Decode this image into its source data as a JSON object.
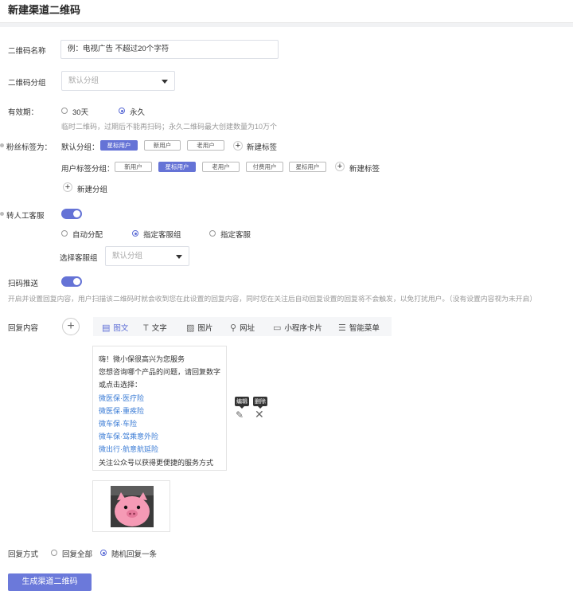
{
  "page": {
    "title": "新建渠道二维码"
  },
  "name_field": {
    "label": "二维码名称",
    "value": "例：电视广告 不超过20个字符"
  },
  "group_field": {
    "label": "二维码分组",
    "placeholder": "默认分组"
  },
  "validity": {
    "label": "有效期：",
    "options": [
      "30天",
      "永久"
    ],
    "selected": "永久",
    "hint": "临时二维码，过期后不能再扫码；永久二维码最大创建数量为10万个"
  },
  "fan_tags": {
    "label": "粉丝标签为：",
    "default_group": {
      "label": "默认分组：",
      "tags": [
        "星标用户",
        "新用户",
        "老用户"
      ],
      "selected": "星标用户",
      "add_label": "新建标签"
    },
    "user_group": {
      "label": "用户标签分组：",
      "tags": [
        "新用户",
        "星标用户",
        "老用户",
        "付费用户",
        "星标用户"
      ],
      "selected_index": 1,
      "add_label": "新建标签"
    },
    "add_group_label": "新建分组"
  },
  "manual_service": {
    "label": "转人工客服",
    "enabled": true,
    "options": [
      "自动分配",
      "指定客服组",
      "指定客服"
    ],
    "selected": "指定客服组",
    "group_select": {
      "label": "选择客服组",
      "placeholder": "默认分组"
    }
  },
  "scan_push": {
    "label": "扫码推送",
    "enabled": true,
    "hint": "开启并设置回复内容，用户扫描该二维码时就会收到您在此设置的回复内容，同时您在关注后自动回复设置的回复将不会触发，以免打扰用户。（没有设置内容视为未开启）"
  },
  "reply": {
    "label": "回复内容",
    "toolbar": [
      {
        "icon": "image-text-icon",
        "label": "图文",
        "active": true
      },
      {
        "icon": "text-icon",
        "label": "文字",
        "active": false
      },
      {
        "icon": "image-icon",
        "label": "图片",
        "active": false
      },
      {
        "icon": "link-icon",
        "label": "网址",
        "active": false
      },
      {
        "icon": "miniprogram-icon",
        "label": "小程序卡片",
        "active": false
      },
      {
        "icon": "menu-icon",
        "label": "智能菜单",
        "active": false
      }
    ],
    "message_lines": [
      {
        "text": "嗨！微小保很高兴为您服务",
        "link": false
      },
      {
        "text": "您想咨询哪个产品的问题，请回复数字",
        "link": false
      },
      {
        "text": "或点击选择：",
        "link": false
      },
      {
        "text": "微医保·医疗险",
        "link": true
      },
      {
        "text": "微医保·重疾险",
        "link": true
      },
      {
        "text": "微车保·车险",
        "link": true
      },
      {
        "text": "微车保·驾乘意外险",
        "link": true
      },
      {
        "text": "微出行·航意航延险",
        "link": true
      },
      {
        "text": "关注公众号以获得更便捷的服务方式",
        "link": false
      }
    ],
    "edit_tip": "编辑",
    "delete_tip": "删除"
  },
  "reply_mode": {
    "label": "回复方式",
    "options": [
      "回复全部",
      "随机回复一条"
    ],
    "selected": "随机回复一条"
  },
  "submit": {
    "label": "生成渠道二维码"
  },
  "colors": {
    "accent": "#6573d6",
    "link": "#3a7bd5",
    "pig": "#f59ab5"
  }
}
